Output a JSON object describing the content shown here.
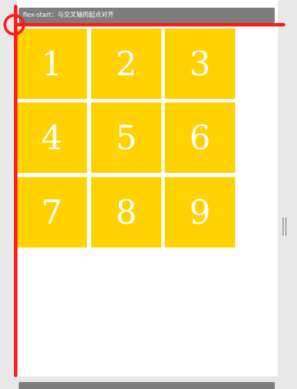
{
  "header": {
    "title": "flex-start：与交叉轴的起点对齐"
  },
  "items": [
    "1",
    "2",
    "3",
    "4",
    "5",
    "6",
    "7",
    "8",
    "9"
  ],
  "colors": {
    "item_background": "#ffd200",
    "axis": "#ff1a1a",
    "header_background": "#7d7d7d"
  }
}
